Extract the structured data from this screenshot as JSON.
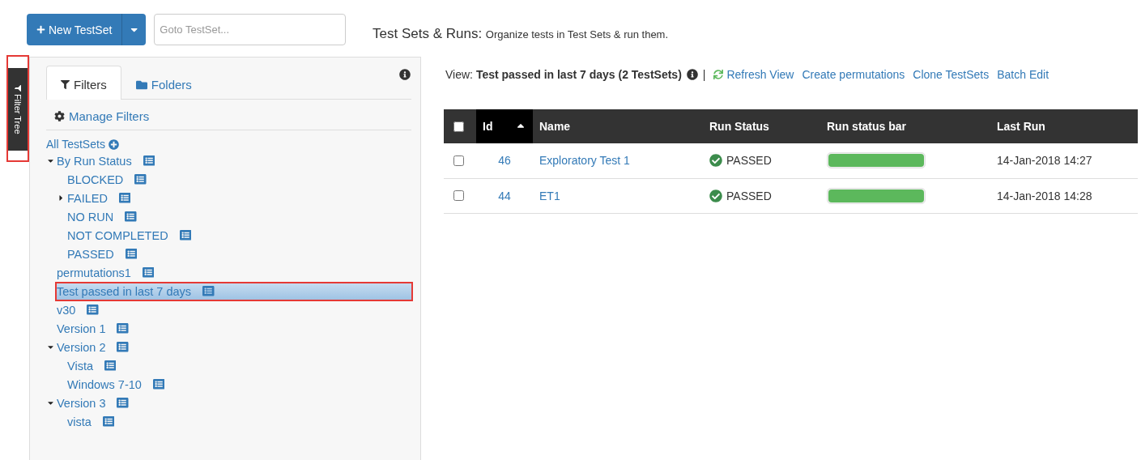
{
  "toolbar": {
    "new_button": "New TestSet",
    "goto": {
      "placeholder": "Goto TestSet..."
    },
    "title": "Test Sets & Runs:",
    "subtitle": "Organize tests in Test Sets & run them."
  },
  "side_tab": {
    "label": "Filter Tree",
    "highlighted": true
  },
  "sidebar": {
    "tabs": [
      {
        "label": "Filters",
        "selected": true
      },
      {
        "label": "Folders",
        "selected": false
      }
    ],
    "manage": "Manage Filters",
    "root": "All TestSets",
    "tree": [
      {
        "label": "By Run Status",
        "expanded": true,
        "children": [
          {
            "label": "BLOCKED"
          },
          {
            "label": "FAILED",
            "expanded": false
          },
          {
            "label": "NO RUN"
          },
          {
            "label": "NOT COMPLETED"
          },
          {
            "label": "PASSED"
          }
        ]
      },
      {
        "label": "permutations1"
      },
      {
        "label": "Test passed in last 7 days",
        "selected": true,
        "highlighted": true
      },
      {
        "label": "v30"
      },
      {
        "label": "Version 1"
      },
      {
        "label": "Version 2",
        "expanded": true,
        "children": [
          {
            "label": "Vista"
          },
          {
            "label": "Windows 7-10"
          }
        ]
      },
      {
        "label": "Version 3",
        "expanded": true,
        "children": [
          {
            "label": "vista"
          }
        ]
      }
    ]
  },
  "view": {
    "prefix": "View:",
    "name": "Test passed in last 7 days (2 TestSets)",
    "separator": "|",
    "actions": [
      {
        "label": "Refresh View"
      },
      {
        "label": "Create permutations"
      },
      {
        "label": "Clone TestSets"
      },
      {
        "label": "Batch Edit"
      }
    ]
  },
  "table": {
    "all_checked": false,
    "columns": [
      {
        "label": "Id",
        "sorted": true
      },
      {
        "label": "Name",
        "sorted": false
      },
      {
        "label": "Run Status",
        "sorted": false
      },
      {
        "label": "Run status bar",
        "sorted": false
      },
      {
        "label": "Last Run",
        "sorted": false
      }
    ],
    "rows": [
      {
        "checked": false,
        "id": "46",
        "name": "Exploratory Test 1",
        "status": "PASSED",
        "level": 1,
        "last_run": "14-Jan-2018 14:27"
      },
      {
        "checked": false,
        "id": "44",
        "name": "ET1",
        "status": "PASSED",
        "level": 1,
        "last_run": "14-Jan-2018 14:28"
      }
    ]
  }
}
